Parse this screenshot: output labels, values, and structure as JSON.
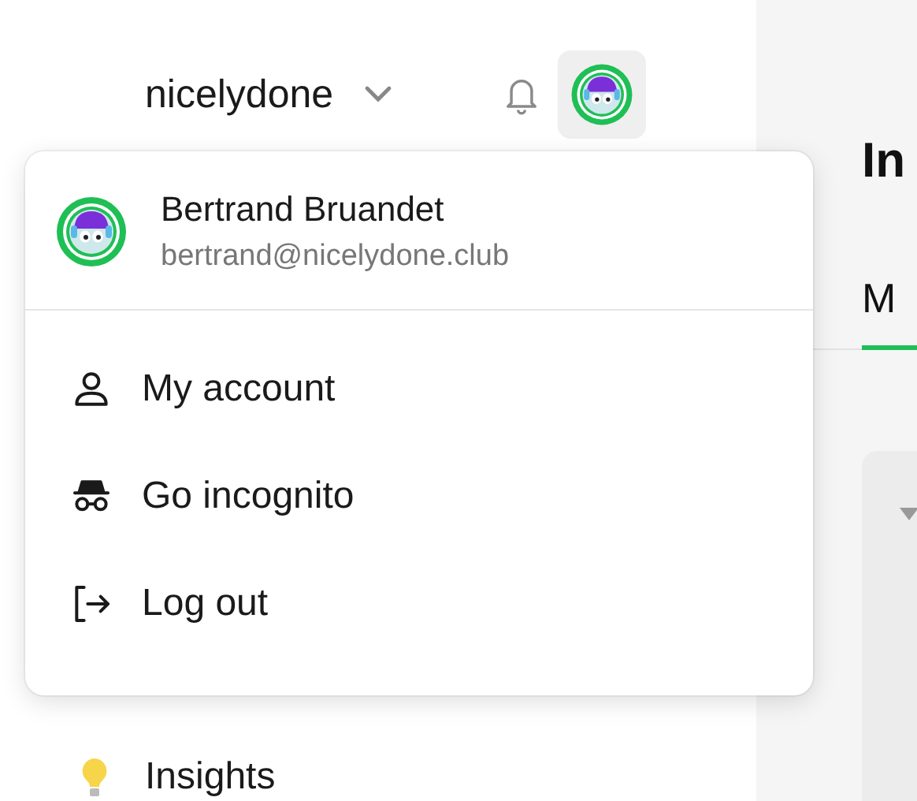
{
  "workspace": {
    "name": "nicelydone"
  },
  "sidebar": {
    "items": [
      {
        "label": "Insights",
        "kind": "insights"
      }
    ]
  },
  "main": {
    "title": "In",
    "tabs": [
      {
        "label": "M",
        "selected": true
      }
    ]
  },
  "user_menu": {
    "name": "Bertrand Bruandet",
    "email": "bertrand@nicelydone.club",
    "items": [
      {
        "label": "My account",
        "kind": "account"
      },
      {
        "label": "Go incognito",
        "kind": "incognito"
      },
      {
        "label": "Log out",
        "kind": "logout"
      }
    ]
  }
}
